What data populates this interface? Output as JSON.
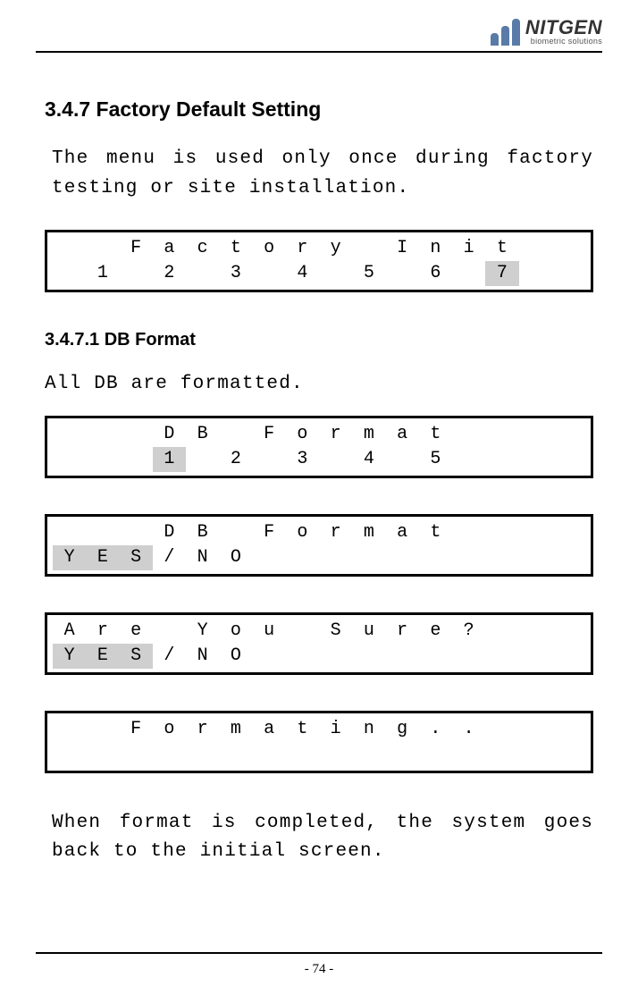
{
  "header": {
    "brand_name": "NITGEN",
    "brand_tagline": "biometric solutions"
  },
  "section": {
    "title": "3.4.7 Factory Default Setting",
    "intro": "The menu is used only once during factory testing or site installation.",
    "sub_title": "3.4.7.1  DB Format",
    "sub_intro": "All DB are formatted.",
    "outro": "When format is completed, the system goes back to the initial screen."
  },
  "lcd": {
    "box1": {
      "row1": [
        "",
        "",
        "F",
        "a",
        "c",
        "t",
        "o",
        "r",
        "y",
        "",
        "I",
        "n",
        "i",
        "t",
        "",
        ""
      ],
      "row2": [
        "",
        "1",
        "",
        "2",
        "",
        "3",
        "",
        "4",
        "",
        "5",
        "",
        "6",
        "",
        "7",
        "",
        ""
      ],
      "row2_highlight": [
        false,
        false,
        false,
        false,
        false,
        false,
        false,
        false,
        false,
        false,
        false,
        false,
        false,
        true,
        false,
        false
      ]
    },
    "box2": {
      "row1": [
        "",
        "",
        "",
        "D",
        "B",
        "",
        "F",
        "o",
        "r",
        "m",
        "a",
        "t",
        "",
        "",
        "",
        ""
      ],
      "row2": [
        "",
        "",
        "",
        "1",
        "",
        "2",
        "",
        "3",
        "",
        "4",
        "",
        "5",
        "",
        "",
        "",
        ""
      ],
      "row2_highlight": [
        false,
        false,
        false,
        true,
        false,
        false,
        false,
        false,
        false,
        false,
        false,
        false,
        false,
        false,
        false,
        false
      ]
    },
    "box3": {
      "row1": [
        "",
        "",
        "",
        "D",
        "B",
        "",
        "F",
        "o",
        "r",
        "m",
        "a",
        "t",
        "",
        "",
        "",
        ""
      ],
      "row2": [
        "Y",
        "E",
        "S",
        "/",
        "N",
        "O",
        "",
        "",
        "",
        "",
        "",
        "",
        "",
        "",
        "",
        ""
      ],
      "row2_highlight": [
        true,
        true,
        true,
        false,
        false,
        false,
        false,
        false,
        false,
        false,
        false,
        false,
        false,
        false,
        false,
        false
      ]
    },
    "box4": {
      "row1": [
        "A",
        "r",
        "e",
        "",
        "Y",
        "o",
        "u",
        "",
        "S",
        "u",
        "r",
        "e",
        "?",
        "",
        "",
        ""
      ],
      "row2": [
        "Y",
        "E",
        "S",
        "/",
        "N",
        "O",
        "",
        "",
        "",
        "",
        "",
        "",
        "",
        "",
        "",
        ""
      ],
      "row2_highlight": [
        true,
        true,
        true,
        false,
        false,
        false,
        false,
        false,
        false,
        false,
        false,
        false,
        false,
        false,
        false,
        false
      ]
    },
    "box5": {
      "row1": [
        "",
        "",
        "F",
        "o",
        "r",
        "m",
        "a",
        "t",
        "i",
        "n",
        "g",
        ".",
        ".",
        "",
        "",
        ""
      ],
      "row2": [
        "",
        "",
        "",
        "",
        "",
        "",
        "",
        "",
        "",
        "",
        "",
        "",
        "",
        "",
        "",
        ""
      ]
    }
  },
  "footer": {
    "page_label": "- 74 -"
  }
}
